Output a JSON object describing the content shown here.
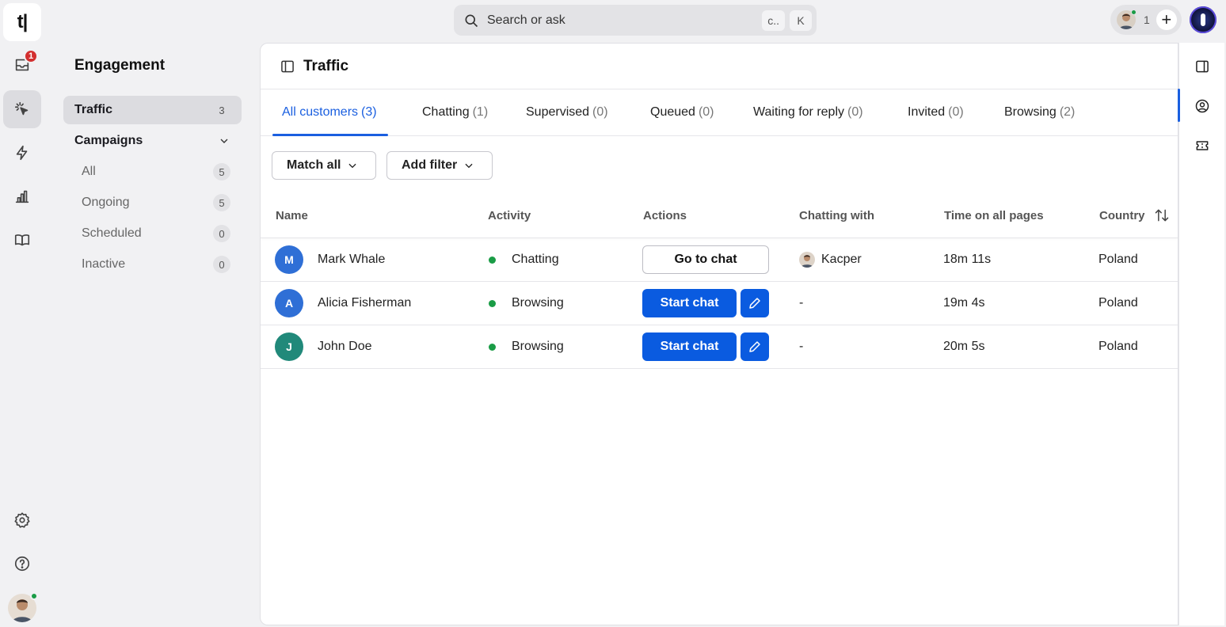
{
  "app": {
    "logo_text": "t|"
  },
  "rail": {
    "inbox_badge": "1"
  },
  "search": {
    "placeholder": "Search or ask",
    "kbd1": "c..",
    "kbd2": "K"
  },
  "topbar": {
    "online_count": "1",
    "plus": "+"
  },
  "sidebar": {
    "title": "Engagement",
    "traffic": {
      "label": "Traffic",
      "count": "3"
    },
    "campaigns": {
      "label": "Campaigns"
    },
    "items": [
      {
        "label": "All",
        "count": "5"
      },
      {
        "label": "Ongoing",
        "count": "5"
      },
      {
        "label": "Scheduled",
        "count": "0"
      },
      {
        "label": "Inactive",
        "count": "0"
      }
    ]
  },
  "main": {
    "title": "Traffic",
    "tabs": [
      {
        "label": "All customers",
        "count": "(3)"
      },
      {
        "label": "Chatting",
        "count": "(1)"
      },
      {
        "label": "Supervised",
        "count": "(0)"
      },
      {
        "label": "Queued",
        "count": "(0)"
      },
      {
        "label": "Waiting for reply",
        "count": "(0)"
      },
      {
        "label": "Invited",
        "count": "(0)"
      },
      {
        "label": "Browsing",
        "count": "(2)"
      }
    ],
    "filters": {
      "match": "Match all",
      "add": "Add filter"
    },
    "columns": [
      "Name",
      "Activity",
      "Actions",
      "Chatting with",
      "Time on all pages",
      "Country"
    ],
    "rows": [
      {
        "initial": "M",
        "name": "Mark Whale",
        "activity": "Chatting",
        "action": "Go to chat",
        "chatting_with": "Kacper",
        "time": "18m 11s",
        "country": "Poland"
      },
      {
        "initial": "A",
        "name": "Alicia Fisherman",
        "activity": "Browsing",
        "action": "Start chat",
        "chatting_with": "-",
        "time": "19m 4s",
        "country": "Poland"
      },
      {
        "initial": "J",
        "name": "John Doe",
        "activity": "Browsing",
        "action": "Start chat",
        "chatting_with": "-",
        "time": "20m 5s",
        "country": "Poland"
      }
    ]
  },
  "colors": {
    "accent": "#0a5be0",
    "status_green": "#1a9c46",
    "avatar_blue": "#2f6fd6",
    "avatar_teal": "#21897a",
    "badge_red": "#d32f2f"
  },
  "icons": [
    "inbox-icon",
    "traffic-cursor-icon",
    "bolt-icon",
    "reports-icon",
    "book-icon",
    "settings-icon",
    "help-icon",
    "search-icon",
    "sidebar-toggle-icon",
    "chevron-down-icon",
    "sort-icon",
    "pencil-icon",
    "panel-icon",
    "user-circle-icon",
    "ticket-icon"
  ]
}
